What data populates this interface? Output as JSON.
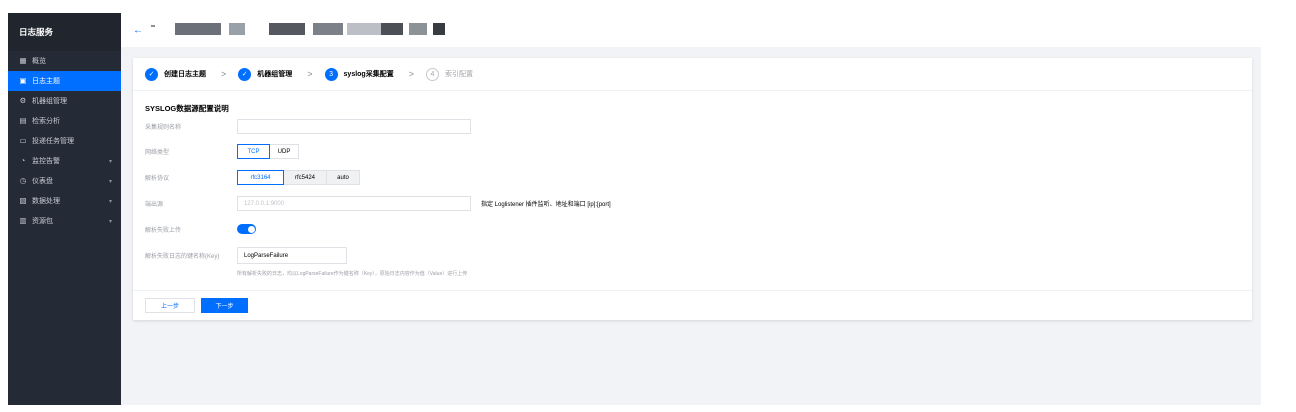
{
  "sidebar": {
    "title": "日志服务",
    "items": [
      {
        "label": "概览",
        "icon": "grid-icon",
        "active": false,
        "chevron": false
      },
      {
        "label": "日志主题",
        "icon": "document-icon",
        "active": true,
        "chevron": false
      },
      {
        "label": "机器组管理",
        "icon": "gear-icon",
        "active": false,
        "chevron": false
      },
      {
        "label": "检索分析",
        "icon": "search-doc-icon",
        "active": false,
        "chevron": false
      },
      {
        "label": "投递任务管理",
        "icon": "monitor-icon",
        "active": false,
        "chevron": false
      },
      {
        "label": "监控告警",
        "icon": "alarm-icon",
        "active": false,
        "chevron": true
      },
      {
        "label": "仪表盘",
        "icon": "dashboard-icon",
        "active": false,
        "chevron": true
      },
      {
        "label": "数据处理",
        "icon": "process-icon",
        "active": false,
        "chevron": true
      },
      {
        "label": "资源包",
        "icon": "package-icon",
        "active": false,
        "chevron": true
      }
    ]
  },
  "topbar": {
    "back_icon": "←"
  },
  "steps": [
    {
      "num": "✓",
      "label": "创建日志主题",
      "state": "done"
    },
    {
      "num": "✓",
      "label": "机器组管理",
      "state": "done"
    },
    {
      "num": "3",
      "label": "syslog采集配置",
      "state": "cur"
    },
    {
      "num": "4",
      "label": "索引配置",
      "state": "todo"
    }
  ],
  "step_separator": ">",
  "form": {
    "section_title": "SYSLOG数据源配置说明",
    "rule_name": {
      "label": "采集规则名称",
      "value": ""
    },
    "network": {
      "label": "网络类型",
      "options": [
        "TCP",
        "UDP"
      ],
      "selected": "TCP"
    },
    "protocol": {
      "label": "解析协议",
      "options": [
        "rfc3164",
        "rfc5424",
        "auto"
      ],
      "selected": "rfc3164"
    },
    "listen": {
      "label": "端出源",
      "placeholder": "127.0.0.1:9000",
      "hint": "指定 Loglistener 插件监听、地址和端口 [ip]:[port]"
    },
    "fail_upload": {
      "label": "解析失败上传",
      "on": true
    },
    "fail_key": {
      "label": "解析失败日志的键名称(Key)",
      "value": "LogParseFailure",
      "help": "所有解析失败的日志，均以LogParseFailure作为键名称（Key），原始日志内容作为值（Value）进行上传"
    }
  },
  "footer": {
    "prev": "上一步",
    "next": "下一步"
  },
  "colors": {
    "accent": "#006eff",
    "sidebar_bg": "#252b36"
  }
}
